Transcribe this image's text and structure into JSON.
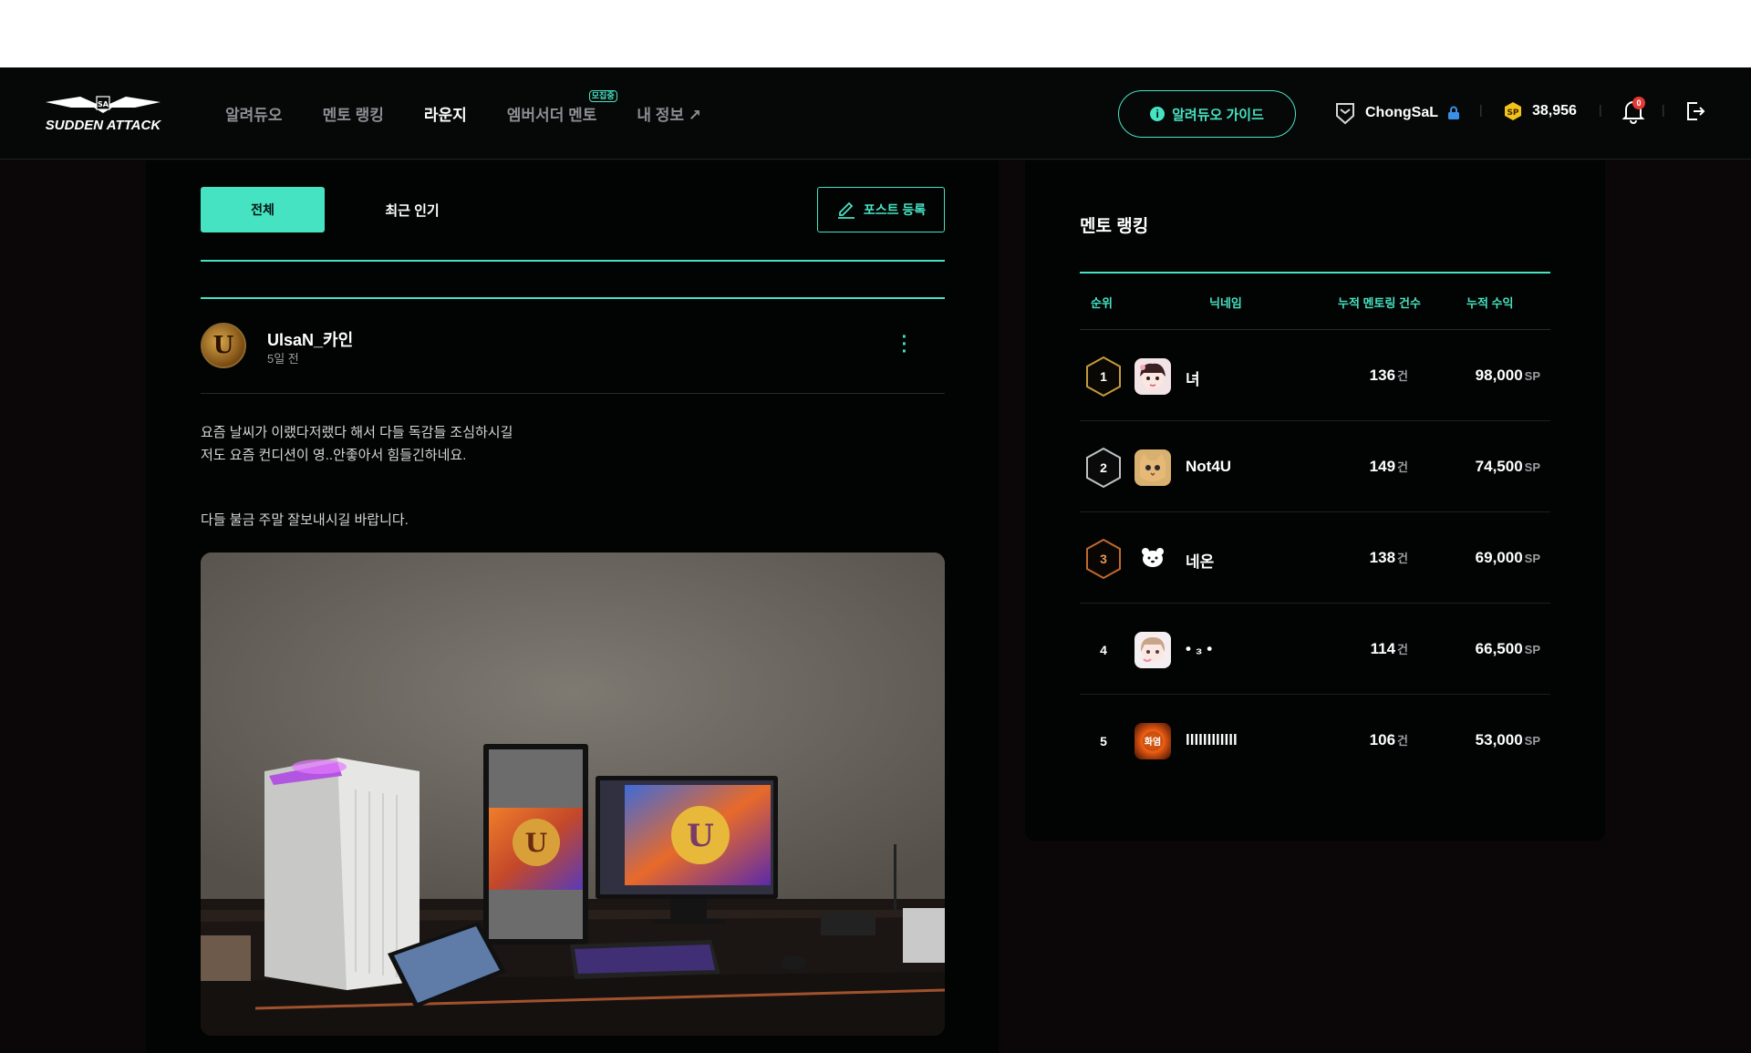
{
  "nav": {
    "logo_alt": "SUDDEN ATTACK",
    "items": [
      {
        "label": "알려듀오",
        "active": false
      },
      {
        "label": "멘토 랭킹",
        "active": false
      },
      {
        "label": "라운지",
        "active": true
      },
      {
        "label": "엠버서더 멘토",
        "active": false,
        "badge": "모집중"
      },
      {
        "label": "내 정보 ↗",
        "active": false
      }
    ],
    "guide_button": "알려듀오 가이드",
    "username": "ChongSaL",
    "points": "38,956",
    "notification_count": "0"
  },
  "lounge": {
    "tabs": {
      "all": "전체",
      "popular": "최근 인기"
    },
    "post_button": "포스트 등록",
    "post": {
      "author": "UlsaN_카인",
      "time": "5일 전",
      "lines": [
        "요즘 날씨가 이랬다저랬다 해서 다들 독감들 조심하시길",
        "저도 요즘 컨디션이 영..안좋아서 힘들긴하네요."
      ],
      "line3": "다들 불금 주말 잘보내시길 바랍니다."
    }
  },
  "ranking": {
    "title": "멘토 랭킹",
    "headers": {
      "rank": "순위",
      "nickname": "닉네임",
      "count": "누적 멘토링 건수",
      "earnings": "누적 수익"
    },
    "count_unit": "건",
    "earn_unit": "SP",
    "rows": [
      {
        "rank": "1",
        "name": "녀",
        "count": "136",
        "earnings": "98,000"
      },
      {
        "rank": "2",
        "name": "Not4U",
        "count": "149",
        "earnings": "74,500"
      },
      {
        "rank": "3",
        "name": "네온",
        "count": "138",
        "earnings": "69,000"
      },
      {
        "rank": "4",
        "name": "• ₃ •",
        "count": "114",
        "earnings": "66,500"
      },
      {
        "rank": "5",
        "name": "llllllllllll",
        "count": "106",
        "earnings": "53,000"
      }
    ]
  },
  "colors": {
    "accent": "#46e3c2",
    "gold": "#c59a3b",
    "bronze": "#c06a2e"
  }
}
